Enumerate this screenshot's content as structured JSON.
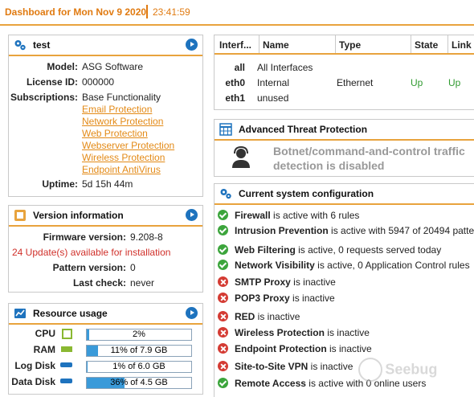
{
  "header": {
    "title": "Dashboard for Mon Nov 9 2020",
    "clock": "23:41:59"
  },
  "system_panel": {
    "title": "test",
    "model_label": "Model:",
    "model_value": "ASG Software",
    "license_label": "License ID:",
    "license_value": "000000",
    "subscriptions_label": "Subscriptions:",
    "subscriptions_base": "Base Functionality",
    "subscriptions": [
      "Email Protection",
      "Network Protection",
      "Web Protection",
      "Webserver Protection",
      "Wireless Protection",
      "Endpoint AntiVirus"
    ],
    "uptime_label": "Uptime:",
    "uptime_value": "5d 15h 44m"
  },
  "version_panel": {
    "title": "Version information",
    "firmware_label": "Firmware version:",
    "firmware_value": "9.208-8",
    "updates_text": "24 Update(s) available for installation",
    "pattern_label": "Pattern version:",
    "pattern_value": "0",
    "lastcheck_label": "Last check:",
    "lastcheck_value": "never"
  },
  "resource_panel": {
    "title": "Resource usage",
    "rows": [
      {
        "label": "CPU",
        "text": "2%",
        "fraction": 0.02
      },
      {
        "label": "RAM",
        "text": "11% of 7.9 GB",
        "fraction": 0.11
      },
      {
        "label": "Log Disk",
        "text": "1% of 6.0 GB",
        "fraction": 0.01
      },
      {
        "label": "Data Disk",
        "text": "36% of 4.5 GB",
        "fraction": 0.36
      }
    ]
  },
  "interfaces": {
    "headers": [
      "Interf...",
      "Name",
      "Type",
      "State",
      "Link"
    ],
    "rows": [
      {
        "iface": "all",
        "name": "All Interfaces",
        "type": "",
        "state": "",
        "link": ""
      },
      {
        "iface": "eth0",
        "name": "Internal",
        "type": "Ethernet",
        "state": "Up",
        "link": "Up"
      },
      {
        "iface": "eth1",
        "name": "unused",
        "type": "",
        "state": "",
        "link": ""
      }
    ]
  },
  "atp_panel": {
    "title": "Advanced Threat Protection",
    "line1": "Botnet/command-and-control traffic",
    "line2": "detection is disabled"
  },
  "config_panel": {
    "title": "Current system configuration",
    "items": [
      {
        "status": "ok",
        "name": "Firewall",
        "detail": " is active with 6 rules"
      },
      {
        "status": "ok",
        "name": "Intrusion Prevention",
        "detail": " is active with 5947 of 20494 patte"
      },
      {
        "status": "ok",
        "name": "Web Filtering",
        "detail": " is active, 0 requests served today"
      },
      {
        "status": "ok",
        "name": "Network Visibility",
        "detail": " is active, 0 Application Control rules"
      },
      {
        "status": "bad",
        "name": "SMTP Proxy",
        "detail": " is inactive"
      },
      {
        "status": "bad",
        "name": "POP3 Proxy",
        "detail": " is inactive"
      },
      {
        "status": "bad",
        "name": "RED",
        "detail": " is inactive"
      },
      {
        "status": "bad",
        "name": "Wireless Protection",
        "detail": " is inactive"
      },
      {
        "status": "bad",
        "name": "Endpoint Protection",
        "detail": " is inactive"
      },
      {
        "status": "bad",
        "name": "Site-to-Site VPN",
        "detail": " is inactive"
      },
      {
        "status": "ok",
        "name": "Remote Access",
        "detail": " is active with 0 online users"
      }
    ]
  },
  "watermark": "Seebug",
  "colors": {
    "accent": "#e8a33d",
    "title_orange": "#e07a10",
    "link_orange": "#e38a17",
    "update_red": "#d0302a",
    "up_green": "#2f9a2f",
    "bar_fill": "#3a9ad9"
  }
}
